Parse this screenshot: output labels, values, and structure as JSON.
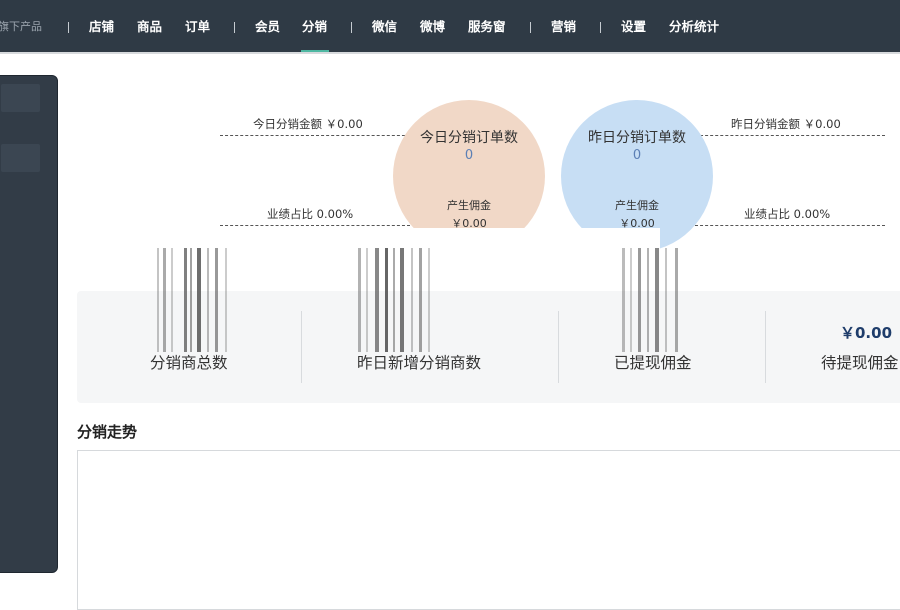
{
  "nav": {
    "items": [
      {
        "label": "旗下产品",
        "muted": true
      },
      {
        "label": "店铺"
      },
      {
        "label": "商品"
      },
      {
        "label": "订单"
      },
      {
        "label": "会员"
      },
      {
        "label": "分销",
        "active": true
      },
      {
        "label": "微信"
      },
      {
        "label": "微博"
      },
      {
        "label": "服务窗"
      },
      {
        "label": "营销"
      },
      {
        "label": "设置"
      },
      {
        "label": "分析统计"
      }
    ],
    "active_color": "#4fb8a2"
  },
  "stats": {
    "today_amount": "今日分销金额 ￥0.00",
    "yesterday_amount": "昨日分销金额 ￥0.00",
    "today_ratio": "业绩占比 0.00%",
    "yesterday_ratio": "业绩占比 0.00%",
    "today_orders": {
      "title": "今日分销订单数",
      "value": "0",
      "commission_label": "产生佣金",
      "commission_value": "￥0.00",
      "color": "#f1d8c7"
    },
    "yesterday_orders": {
      "title": "昨日分销订单数",
      "value": "0",
      "commission_label": "产生佣金",
      "commission_value": "￥0.00",
      "color": "#c7def4"
    }
  },
  "summary": {
    "items": [
      {
        "label": "分销商总数"
      },
      {
        "label": "昨日新增分销商数"
      },
      {
        "label": "已提现佣金"
      },
      {
        "label": "待提现佣金",
        "value": "￥0.00"
      }
    ]
  },
  "trend": {
    "title": "分销走势"
  }
}
